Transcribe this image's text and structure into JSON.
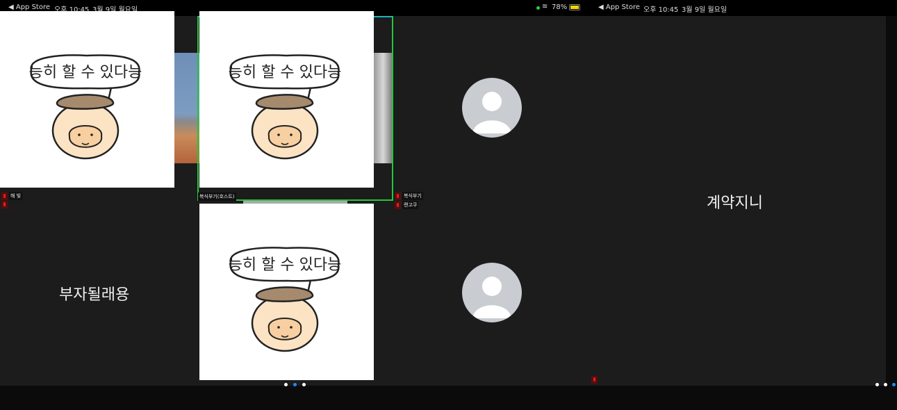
{
  "status_left": {
    "back_app": "◀ App Store",
    "time": "오후 10:45",
    "date": "3월 9일 월요일"
  },
  "status_right": {
    "battery": "78%",
    "back_app": "◀ App Store",
    "time": "오후 10:45",
    "date": "3월 9일 월요일"
  },
  "sticker_text": "능히 할 수 있다능",
  "participants": [
    {
      "name": "해 빛"
    },
    {
      "name": "복식부기(호스트)"
    },
    {
      "name": "복식부기"
    },
    {
      "name": "랜고쿠"
    },
    {
      "name": "부자될래용"
    },
    {
      "name": "계약지니"
    }
  ],
  "colors": {
    "active_speaker": "#22c83a",
    "pin": "#1fb3c0",
    "page_dot_active": "#1a8cff"
  }
}
